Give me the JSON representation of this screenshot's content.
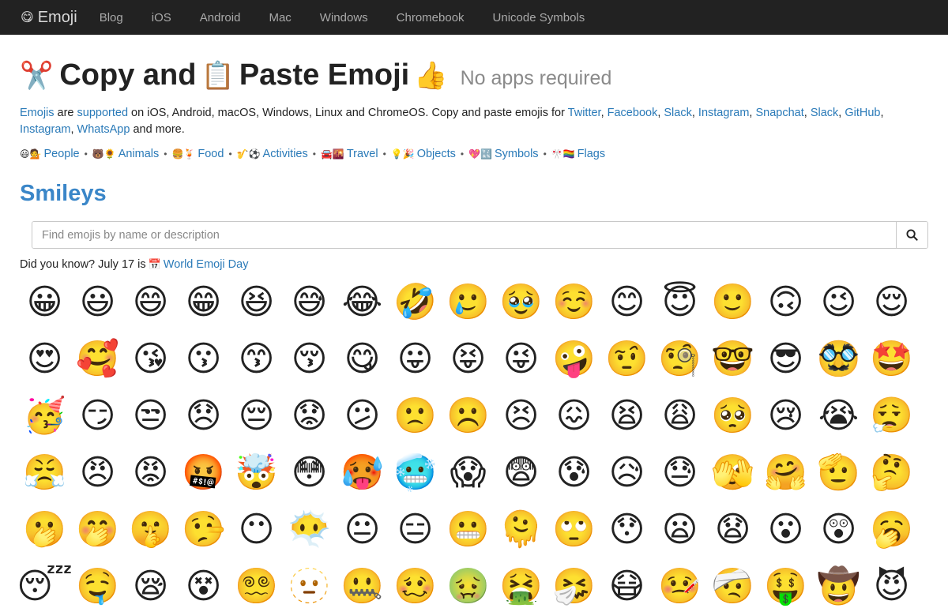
{
  "nav": {
    "brand_icon": "😋",
    "brand": "Emoji",
    "links": [
      "Blog",
      "iOS",
      "Android",
      "Mac",
      "Windows",
      "Chromebook",
      "Unicode Symbols"
    ]
  },
  "headline": {
    "icon1": "✂️",
    "text1": "Copy and",
    "icon2": "📋",
    "text2": "Paste Emoji",
    "icon3": "👍",
    "subtitle": "No apps required"
  },
  "intro": {
    "emojis": "Emojis",
    "are": " are ",
    "supported": "supported",
    "platforms": " on iOS, Android, macOS, Windows, Linux and ChromeOS. Copy and paste emojis for ",
    "links": [
      "Twitter",
      "Facebook",
      "Slack",
      "Instagram",
      "Snapchat",
      "Slack",
      "GitHub",
      "Instagram",
      "WhatsApp"
    ],
    "comma": ", ",
    "tail": " and more."
  },
  "categories": [
    {
      "icon": "😃💁",
      "label": "People"
    },
    {
      "icon": "🐻🌻",
      "label": "Animals"
    },
    {
      "icon": "🍔🍹",
      "label": "Food"
    },
    {
      "icon": "🎷⚽️",
      "label": "Activities"
    },
    {
      "icon": "🚘🌇",
      "label": "Travel"
    },
    {
      "icon": "💡🎉",
      "label": "Objects"
    },
    {
      "icon": "💖🔣",
      "label": "Symbols"
    },
    {
      "icon": "🎌🏳️‍🌈",
      "label": "Flags"
    }
  ],
  "category_separator": "•",
  "section_title": "Smileys",
  "search": {
    "placeholder": "Find emojis by name or description",
    "icon": "search-icon"
  },
  "didyouknow": {
    "prefix": "Did you know? July 17 is ",
    "icon": "📅",
    "link": "World Emoji Day"
  },
  "emojis": [
    "😀",
    "😃",
    "😄",
    "😁",
    "😆",
    "😅",
    "😂",
    "🤣",
    "🥲",
    "🥹",
    "☺️",
    "😊",
    "😇",
    "🙂",
    "🙃",
    "😉",
    "😌",
    "😍",
    "🥰",
    "😘",
    "😗",
    "😙",
    "😚",
    "😋",
    "😛",
    "😝",
    "😜",
    "🤪",
    "🤨",
    "🧐",
    "🤓",
    "😎",
    "🥸",
    "🤩",
    "🥳",
    "😏",
    "😒",
    "😞",
    "😔",
    "😟",
    "😕",
    "🙁",
    "☹️",
    "😣",
    "😖",
    "😫",
    "😩",
    "🥺",
    "😢",
    "😭",
    "😮‍💨",
    "😤",
    "😠",
    "😡",
    "🤬",
    "🤯",
    "😳",
    "🥵",
    "🥶",
    "😱",
    "😨",
    "😰",
    "😥",
    "😓",
    "🫣",
    "🤗",
    "🫡",
    "🤔",
    "🫢",
    "🤭",
    "🤫",
    "🤥",
    "😶",
    "😶‍🌫️",
    "😐",
    "😑",
    "😬",
    "🫠",
    "🙄",
    "😯",
    "😦",
    "😧",
    "😮",
    "😲",
    "🥱",
    "😴",
    "🤤",
    "😪",
    "😵",
    "😵‍💫",
    "🫥",
    "🤐",
    "🥴",
    "🤢",
    "🤮",
    "🤧",
    "😷",
    "🤒",
    "🤕",
    "🤑",
    "🤠",
    "😈"
  ]
}
